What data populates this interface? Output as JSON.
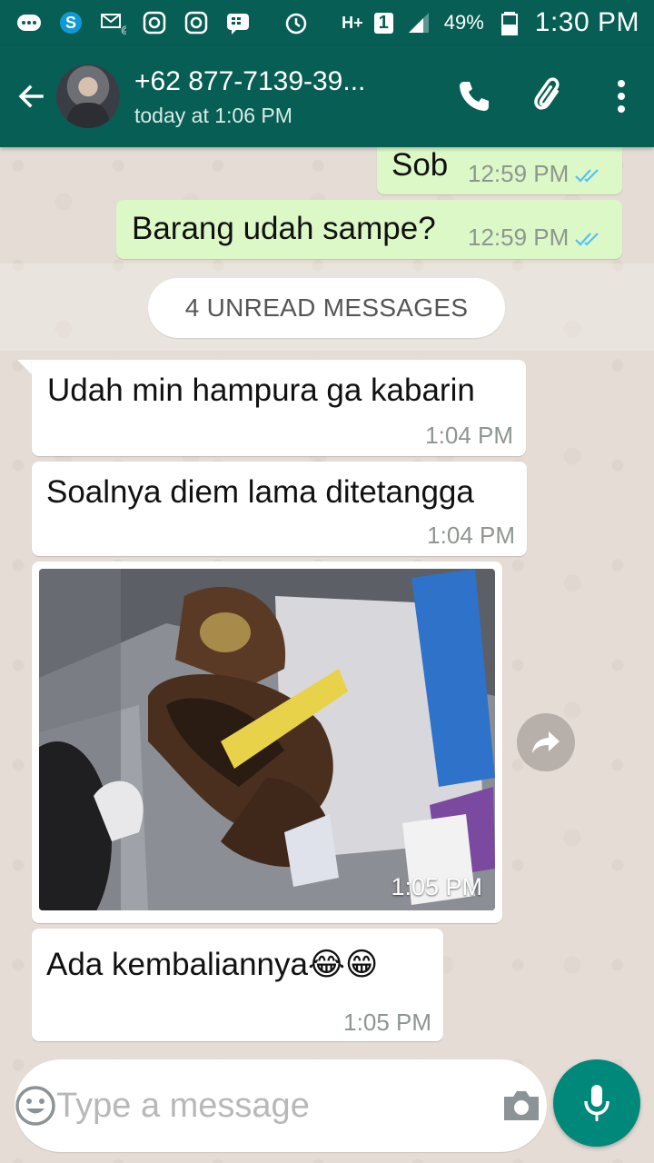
{
  "status_bar": {
    "battery": "49%",
    "time": "1:30 PM",
    "network": "H+",
    "sim": "1",
    "icons": [
      "chat-notification-icon",
      "skype-icon",
      "missed-email-icon",
      "instagram-icon",
      "instagram-icon",
      "bbm-icon",
      "alarm-icon",
      "data-arrows-icon",
      "signal-icon",
      "battery-icon"
    ]
  },
  "header": {
    "contact_name": "+62 877-7139-39...",
    "last_seen": "today at 1:06 PM"
  },
  "messages": [
    {
      "direction": "out",
      "text": "Sob",
      "time": "12:59 PM",
      "status": "read"
    },
    {
      "direction": "out",
      "text": "Barang udah sampe?",
      "time": "12:59 PM",
      "status": "read"
    },
    {
      "direction": "in",
      "text": "Udah min hampura ga kabarin",
      "time": "1:04 PM"
    },
    {
      "direction": "in",
      "text": "Soalnya diem lama ditetangga",
      "time": "1:04 PM"
    },
    {
      "direction": "in",
      "type": "image",
      "time": "1:05 PM"
    },
    {
      "direction": "in",
      "text": "Ada kembaliannya😂😁",
      "time": "1:05 PM"
    }
  ],
  "unread_banner": "4 UNREAD MESSAGES",
  "composer": {
    "placeholder": "Type a message"
  },
  "colors": {
    "header": "#075e54",
    "outgoing_bubble": "#dcf8c6",
    "incoming_bubble": "#ffffff",
    "read_ticks": "#4fc3f7",
    "mic_button": "#00897b"
  }
}
